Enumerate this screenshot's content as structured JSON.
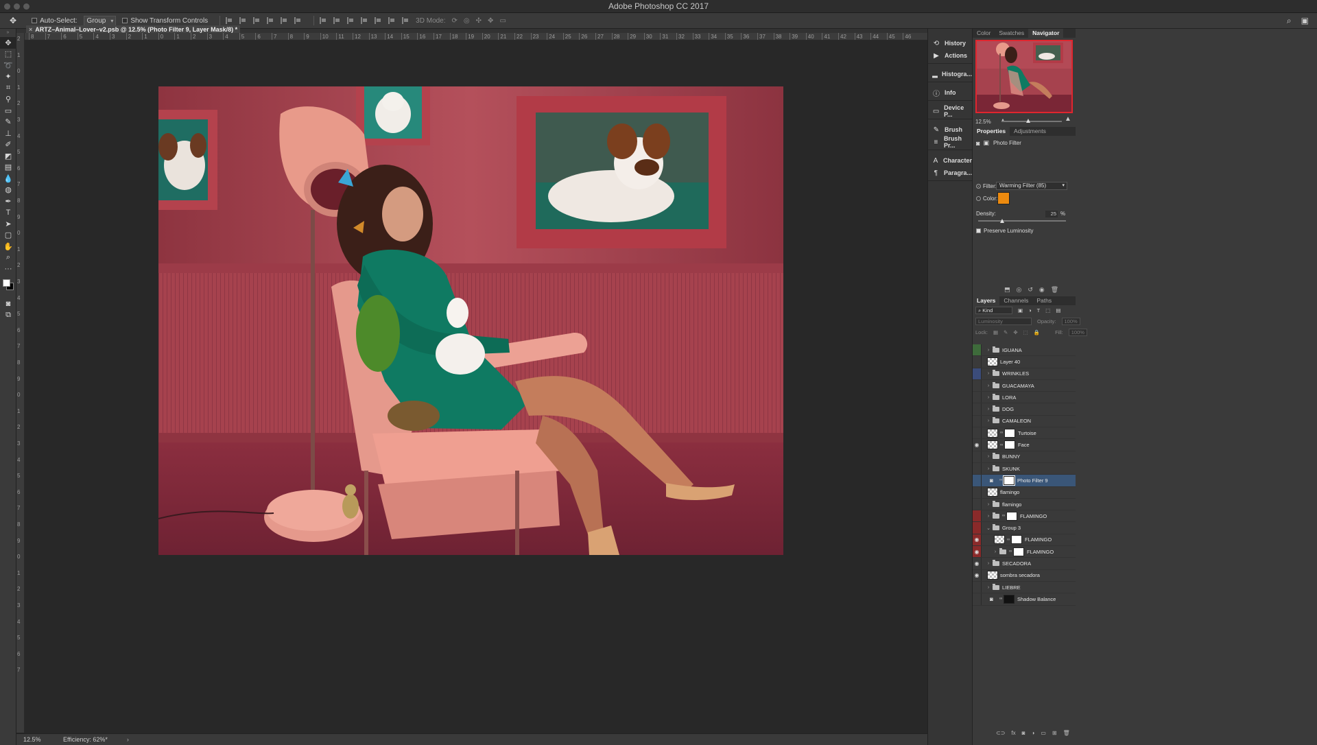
{
  "app": {
    "title": "Adobe Photoshop CC 2017"
  },
  "options_bar": {
    "auto_select_label": "Auto-Select:",
    "auto_select_value": "Group",
    "show_transform_label": "Show Transform Controls",
    "mode_3d_label": "3D Mode:"
  },
  "document": {
    "tab_title": "ARTZ–Animal–Lover–v2.psb @ 12.5% (Photo Filter 9, Layer Mask/8) *",
    "ruler_top": [
      "8",
      "7",
      "6",
      "5",
      "4",
      "3",
      "2",
      "1",
      "0",
      "1",
      "2",
      "3",
      "4",
      "5",
      "6",
      "7",
      "8",
      "9",
      "10",
      "11",
      "12",
      "13",
      "14",
      "15",
      "16",
      "17",
      "18",
      "19",
      "20",
      "21",
      "22",
      "23",
      "24",
      "25",
      "26",
      "27",
      "28",
      "29",
      "30",
      "31",
      "32",
      "33",
      "34",
      "35",
      "36",
      "37",
      "38",
      "39",
      "40",
      "41",
      "42",
      "43",
      "44",
      "45",
      "46"
    ],
    "ruler_left": [
      "2",
      "1",
      "0",
      "1",
      "2",
      "3",
      "4",
      "5",
      "6",
      "7",
      "8",
      "9",
      "0",
      "1",
      "2",
      "3",
      "4",
      "5",
      "6",
      "7",
      "8",
      "9",
      "0",
      "1",
      "2",
      "3",
      "4",
      "5",
      "6",
      "7",
      "8",
      "9",
      "0",
      "1",
      "2",
      "3",
      "4",
      "5",
      "6",
      "7"
    ]
  },
  "status_bar": {
    "zoom": "12.5%",
    "efficiency": "Efficiency: 62%*"
  },
  "dock": [
    {
      "icon": "history-icon",
      "glyph": "⟲",
      "label": "History"
    },
    {
      "icon": "play-icon",
      "glyph": "▶",
      "label": "Actions"
    },
    {
      "icon": "histogram-icon",
      "glyph": "▂",
      "label": "Histogra..."
    },
    {
      "icon": "info-icon",
      "glyph": "ⓘ",
      "label": "Info"
    },
    {
      "icon": "device-preview-icon",
      "glyph": "▭",
      "label": "Device P..."
    },
    {
      "icon": "brush-icon",
      "glyph": "✎",
      "label": "Brush"
    },
    {
      "icon": "brush-presets-icon",
      "glyph": "≡",
      "label": "Brush Pr..."
    },
    {
      "icon": "character-icon",
      "glyph": "A",
      "label": "Character"
    },
    {
      "icon": "paragraph-icon",
      "glyph": "¶",
      "label": "Paragra..."
    }
  ],
  "navigator": {
    "tabs": [
      "Color",
      "Swatches",
      "Navigator"
    ],
    "active_tab": "Navigator",
    "zoom": "12.5%"
  },
  "properties": {
    "tabs": [
      "Properties",
      "Adjustments"
    ],
    "active_tab": "Properties",
    "adjustment_name": "Photo Filter",
    "filter_label": "Filter:",
    "filter_value": "Warming Filter (85)",
    "color_label": "Color:",
    "color_value": "#ec8a0f",
    "density_label": "Density:",
    "density_value": "25",
    "density_unit": "%",
    "density_level": 0.25,
    "preserve_luminosity_label": "Preserve Luminosity",
    "preserve_luminosity_checked": true
  },
  "layers": {
    "tabs": [
      "Layers",
      "Channels",
      "Paths"
    ],
    "active_tab": "Layers",
    "kind_label": "Kind",
    "blend_mode": "Luminosity",
    "opacity_label": "Opacity:",
    "opacity_value": "100%",
    "lock_label": "Lock:",
    "fill_label": "Fill:",
    "fill_value": "100%",
    "items": [
      {
        "name": "IGUANA",
        "type": "group",
        "eye": false,
        "color": "#3e6b3b",
        "indent": 0
      },
      {
        "name": "Layer 40",
        "type": "pixel",
        "eye": false,
        "color": "",
        "indent": 0
      },
      {
        "name": "WRINKLES",
        "type": "group",
        "eye": false,
        "color": "#3b4c7a",
        "indent": 0
      },
      {
        "name": "GUACAMAYA",
        "type": "group",
        "eye": false,
        "color": "",
        "indent": 0
      },
      {
        "name": "LORA",
        "type": "group",
        "eye": false,
        "color": "",
        "indent": 0
      },
      {
        "name": "DOG",
        "type": "group",
        "eye": false,
        "color": "",
        "indent": 0
      },
      {
        "name": "CAMALEON",
        "type": "group",
        "eye": false,
        "color": "",
        "indent": 0
      },
      {
        "name": "Turtoise",
        "type": "masked",
        "eye": false,
        "color": "",
        "indent": 0
      },
      {
        "name": "Face",
        "type": "masked",
        "eye": true,
        "color": "",
        "indent": 0
      },
      {
        "name": "BUNNY",
        "type": "group",
        "eye": false,
        "color": "",
        "indent": 0
      },
      {
        "name": "SKUNK",
        "type": "group",
        "eye": false,
        "color": "",
        "indent": 0
      },
      {
        "name": "Photo Filter 9",
        "type": "adjustment",
        "eye": false,
        "color": "",
        "indent": 0,
        "selected": true
      },
      {
        "name": "flamingo",
        "type": "pixel",
        "eye": false,
        "color": "",
        "indent": 0
      },
      {
        "name": "flamingo",
        "type": "group",
        "eye": false,
        "color": "",
        "indent": 0
      },
      {
        "name": "FLAMINGO",
        "type": "group-masked",
        "eye": false,
        "color": "#8a2a2a",
        "indent": 0
      },
      {
        "name": "Group 3",
        "type": "group-open",
        "eye": false,
        "color": "#8a2a2a",
        "indent": 0
      },
      {
        "name": "FLAMINGO",
        "type": "masked",
        "eye": true,
        "color": "#8a2a2a",
        "indent": 1
      },
      {
        "name": "FLAMINGO",
        "type": "group-masked",
        "eye": true,
        "color": "#8a2a2a",
        "indent": 1
      },
      {
        "name": "SECADORA",
        "type": "group",
        "eye": true,
        "color": "",
        "indent": 0
      },
      {
        "name": "sombra secadora",
        "type": "pixel",
        "eye": true,
        "color": "",
        "indent": 0
      },
      {
        "name": "LIEBRE",
        "type": "group",
        "eye": false,
        "color": "",
        "indent": 0
      },
      {
        "name": "Shadow Balance",
        "type": "adjustment-dark",
        "eye": false,
        "color": "",
        "indent": 0
      }
    ]
  },
  "colors": {
    "accent_selected": "#3a5678",
    "wall": "#a63d4a",
    "dress": "#0f7a62",
    "chair": "#e5998c"
  }
}
